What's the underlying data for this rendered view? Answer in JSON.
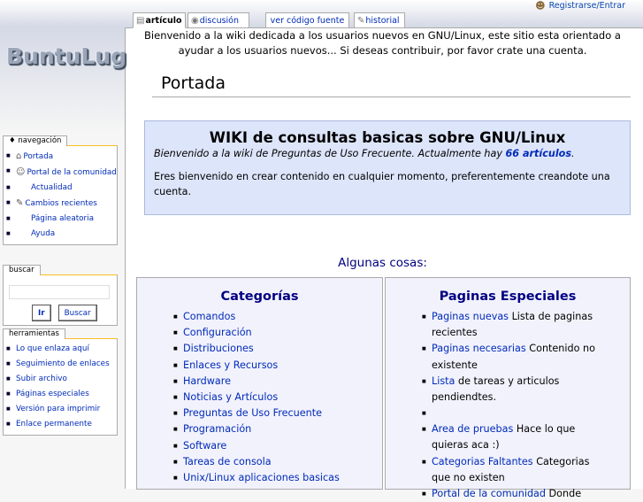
{
  "personal_tools": {
    "login_label": "Registrarse/Entrar"
  },
  "tabs": [
    {
      "label": "artículo"
    },
    {
      "label": "discusión"
    },
    {
      "label": "ver código fuente"
    },
    {
      "label": "historial"
    }
  ],
  "logo_text": "BuntuLug",
  "sidebar": {
    "navigation": {
      "title": "navegación",
      "items": [
        {
          "label": "Portada"
        },
        {
          "label": "Portal de la comunidad"
        },
        {
          "label": "Actualidad"
        },
        {
          "label": "Cambios recientes"
        },
        {
          "label": "Página aleatoria"
        },
        {
          "label": "Ayuda"
        }
      ]
    },
    "search": {
      "title": "buscar",
      "go_label": "Ir",
      "search_label": "Buscar"
    },
    "tools": {
      "title": "herramientas",
      "items": [
        {
          "label": "Lo que enlaza aquí"
        },
        {
          "label": "Seguimiento de enlaces"
        },
        {
          "label": "Subir archivo"
        },
        {
          "label": "Páginas especiales"
        },
        {
          "label": "Versión para imprimir"
        },
        {
          "label": "Enlace permanente"
        }
      ]
    }
  },
  "site_notice": "Bienvenido a la wiki dedicada a los usuarios nuevos en GNU/Linux, este sitio esta orientado a ayudar a los usuarios nuevos... Si deseas contribuir, por favor crate una cuenta.",
  "page_title": "Portada",
  "intro": {
    "title": "WIKI de consultas basicas sobre GNU/Linux",
    "subtitle_pre": "Bienvenido a la wiki de Preguntas de Uso Frecuente. Actualmente hay ",
    "article_count": "66 artículos",
    "subtitle_post": ".",
    "text": "Eres bienvenido en crear contenido en cualquier momento, preferentemente creandote una cuenta."
  },
  "section_heading": "Algunas cosas:",
  "categories": {
    "title": "Categorías",
    "items": [
      "Comandos",
      "Configuración",
      "Distribuciones",
      "Enlaces y Recursos",
      "Hardware",
      "Noticias y Artículos",
      "Preguntas de Uso Frecuente",
      "Programación",
      "Software",
      "Tareas de consola",
      "Unix/Linux aplicaciones basicas"
    ]
  },
  "special_pages": {
    "title": "Paginas Especiales",
    "items": [
      {
        "link": "Paginas nuevas",
        "desc": " Lista de paginas recientes"
      },
      {
        "link": "Paginas necesarias",
        "desc": " Contenido no existente"
      },
      {
        "link": "Lista",
        "desc": " de tareas y articulos pendiendtes."
      },
      {
        "link": "",
        "desc": ""
      },
      {
        "link": "Area de pruebas",
        "desc": " Hace lo que quieras aca :)"
      },
      {
        "link": "Categorias Faltantes",
        "desc": " Categorias que no existen"
      },
      {
        "link": "Portal de la comunidad",
        "desc": " Donde"
      }
    ]
  }
}
